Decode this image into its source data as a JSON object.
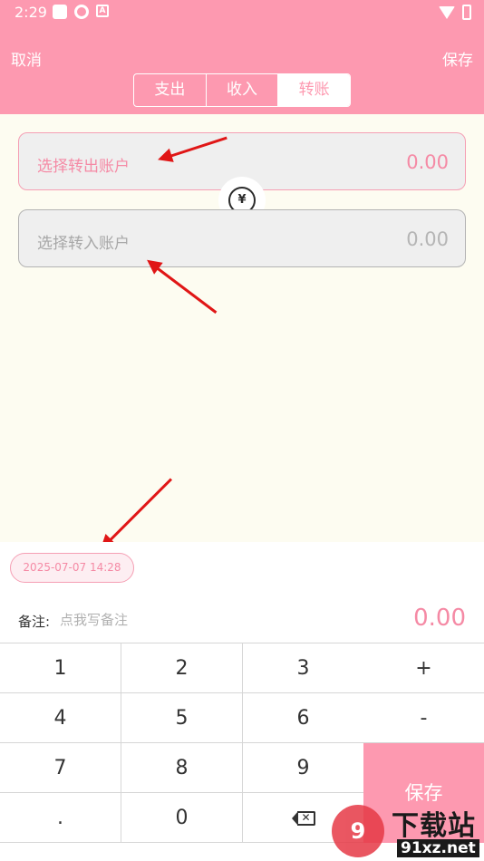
{
  "status_bar": {
    "time": "2:29"
  },
  "header": {
    "cancel_label": "取消",
    "save_label": "保存",
    "tabs": [
      {
        "label": "支出",
        "active": false
      },
      {
        "label": "收入",
        "active": false
      },
      {
        "label": "转账",
        "active": true
      }
    ]
  },
  "transfer": {
    "from": {
      "placeholder": "选择转出账户",
      "amount": "0.00"
    },
    "to": {
      "placeholder": "选择转入账户",
      "amount": "0.00"
    },
    "swap_icon": "yen-swap-icon"
  },
  "bottom": {
    "date": "2025-07-07 14:28",
    "note_label": "备注:",
    "note_placeholder": "点我写备注",
    "total": "0.00"
  },
  "keypad": {
    "keys": [
      "1",
      "2",
      "3",
      "+",
      "4",
      "5",
      "6",
      "-",
      "7",
      "8",
      "9",
      ".",
      "0"
    ],
    "save_label": "保存",
    "backspace_icon": "backspace-icon"
  },
  "watermark": {
    "title": "下载站",
    "url": "91xz.net",
    "logo": "9"
  },
  "colors": {
    "accent": "#fd99b0",
    "accent_text": "#f58aa5",
    "background": "#fdfcf1",
    "annotation": "#e01616"
  }
}
